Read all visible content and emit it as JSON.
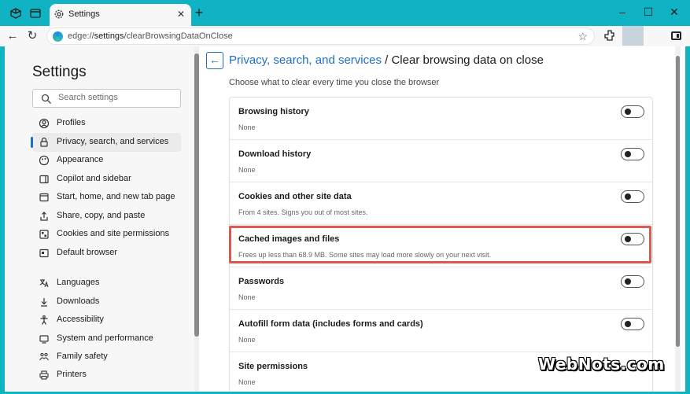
{
  "tab": {
    "title": "Settings"
  },
  "address": {
    "prefix": "edge://",
    "bold": "settings",
    "suffix": "/clearBrowsingDataOnClose"
  },
  "sidebar": {
    "title": "Settings",
    "search_placeholder": "Search settings",
    "items": [
      {
        "label": "Profiles",
        "icon": "profile-icon"
      },
      {
        "label": "Privacy, search, and services",
        "icon": "lock-icon",
        "active": true
      },
      {
        "label": "Appearance",
        "icon": "appearance-icon"
      },
      {
        "label": "Copilot and sidebar",
        "icon": "sidebar-icon"
      },
      {
        "label": "Start, home, and new tab page",
        "icon": "home-icon"
      },
      {
        "label": "Share, copy, and paste",
        "icon": "share-icon"
      },
      {
        "label": "Cookies and site permissions",
        "icon": "cookie-icon"
      },
      {
        "label": "Default browser",
        "icon": "browser-icon"
      },
      {
        "label": "Languages",
        "icon": "languages-icon"
      },
      {
        "label": "Downloads",
        "icon": "download-icon"
      },
      {
        "label": "Accessibility",
        "icon": "accessibility-icon"
      },
      {
        "label": "System and performance",
        "icon": "system-icon"
      },
      {
        "label": "Family safety",
        "icon": "family-icon"
      },
      {
        "label": "Printers",
        "icon": "printer-icon"
      }
    ]
  },
  "main": {
    "breadcrumb_link": "Privacy, search, and services",
    "breadcrumb_current": " / Clear browsing data on close",
    "subtitle": "Choose what to clear every time you close the browser",
    "rows": [
      {
        "title": "Browsing history",
        "sub": "None",
        "enabled": false
      },
      {
        "title": "Download history",
        "sub": "None",
        "enabled": false
      },
      {
        "title": "Cookies and other site data",
        "sub": "From 4 sites. Signs you out of most sites.",
        "enabled": false
      },
      {
        "title": "Cached images and files",
        "sub": "Frees up less than 68.9 MB. Some sites may load more slowly on your next visit.",
        "enabled": false
      },
      {
        "title": "Passwords",
        "sub": "None",
        "enabled": false
      },
      {
        "title": "Autofill form data (includes forms and cards)",
        "sub": "None",
        "enabled": false
      },
      {
        "title": "Site permissions",
        "sub": "None",
        "enabled": false
      }
    ]
  },
  "watermark": "WebNots.com"
}
